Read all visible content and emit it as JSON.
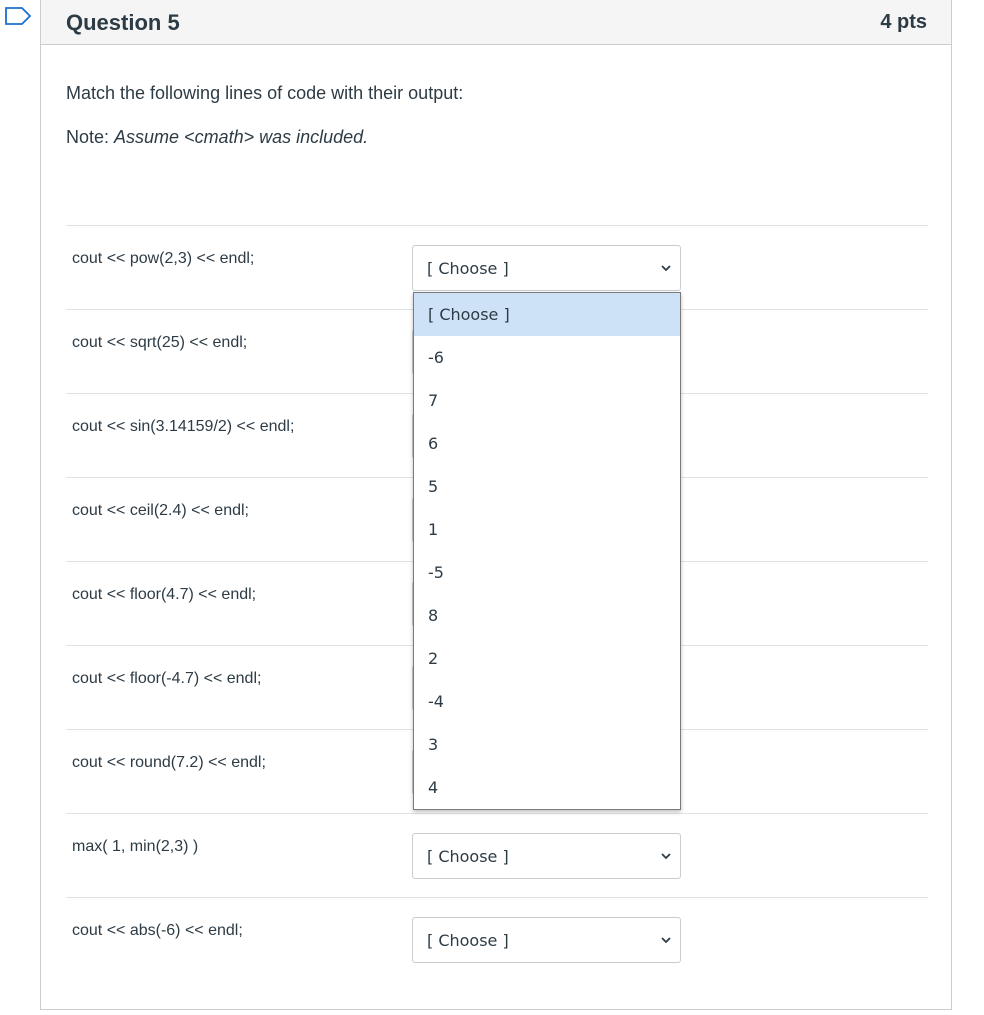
{
  "question": {
    "title": "Question 5",
    "points": "4 pts",
    "prompt": "Match the following lines of code with their output:",
    "note_label": "Note: ",
    "note_text": "Assume <cmath> was included."
  },
  "rows": [
    {
      "label": "cout << pow(2,3) << endl;",
      "selected": "[ Choose ]"
    },
    {
      "label": "cout << sqrt(25) << endl;",
      "selected": "[ Choose ]"
    },
    {
      "label": "cout << sin(3.14159/2) << endl;",
      "selected": "[ Choose ]"
    },
    {
      "label": "cout << ceil(2.4) << endl;",
      "selected": "[ Choose ]"
    },
    {
      "label": "cout << floor(4.7) << endl;",
      "selected": "[ Choose ]"
    },
    {
      "label": "cout << floor(-4.7) << endl;",
      "selected": "[ Choose ]"
    },
    {
      "label": "cout << round(7.2) << endl;",
      "selected": "[ Choose ]"
    },
    {
      "label": "max( 1, min(2,3) )",
      "selected": "[ Choose ]"
    },
    {
      "label": "cout << abs(-6) << endl;",
      "selected": "[ Choose ]"
    }
  ],
  "dropdown": {
    "options": [
      "[ Choose ]",
      "-6",
      "7",
      "6",
      "5",
      "1",
      "-5",
      "8",
      "2",
      "-4",
      "3",
      "4"
    ],
    "highlighted": "[ Choose ]"
  },
  "icons": {
    "flag": "flag-outline-icon",
    "chevron": "chevron-down-icon"
  },
  "colors": {
    "highlight": "#cde2f7",
    "text": "#2d3b45",
    "flag": "#1a6fd1"
  }
}
